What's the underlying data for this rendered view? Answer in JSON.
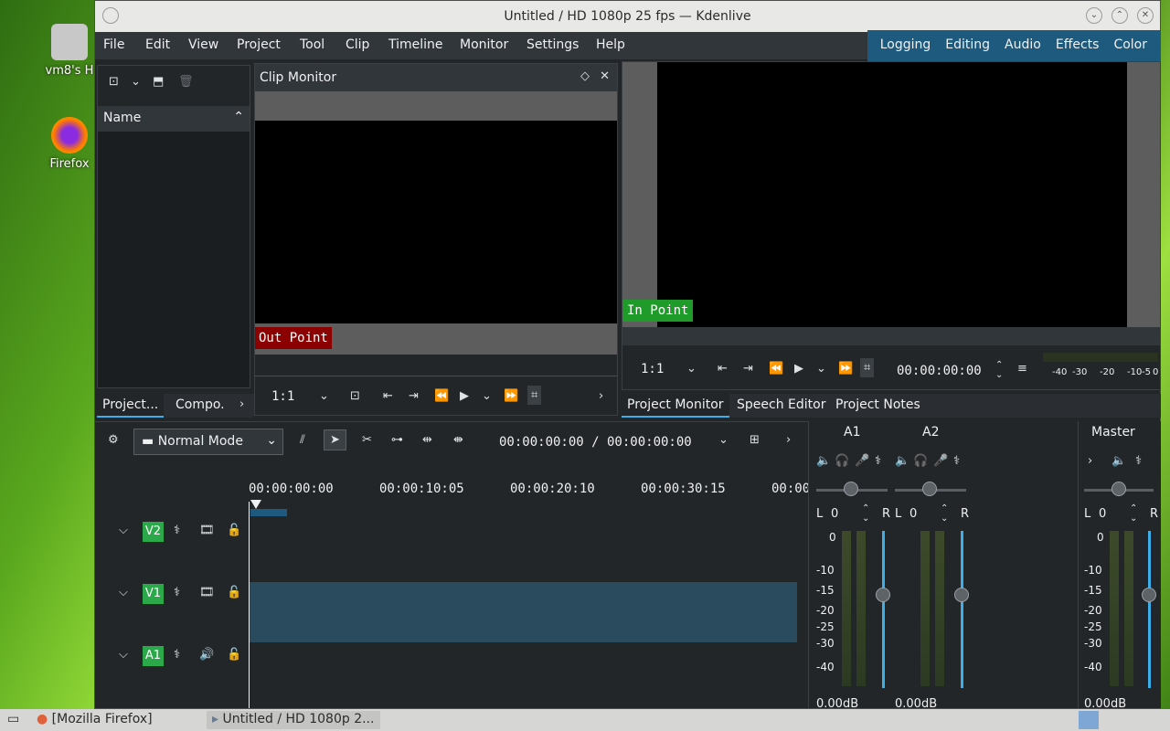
{
  "desktop": {
    "icons": [
      {
        "label": "vm8's H",
        "icon": "home-folder-icon"
      },
      {
        "label": "Firefox",
        "icon": "firefox-icon"
      }
    ]
  },
  "window": {
    "title": "Untitled / HD 1080p 25 fps — Kdenlive",
    "controls": {
      "minimize": "⌄",
      "maximize": "⌃",
      "close": "✕"
    }
  },
  "menubar": {
    "items": [
      "File",
      "Edit",
      "View",
      "Project",
      "Tool",
      "Clip",
      "Timeline",
      "Monitor",
      "Settings",
      "Help"
    ]
  },
  "layouts": [
    "Logging",
    "Editing",
    "Audio",
    "Effects",
    "Color"
  ],
  "bin": {
    "column_header": "Name",
    "tabs": [
      "Project...",
      "Compo."
    ]
  },
  "clip_monitor": {
    "title": "Clip Monitor",
    "out_point": "Out Point",
    "zoom": "1:1"
  },
  "project_monitor": {
    "in_point": "In Point",
    "zoom": "1:1",
    "timecode": "00:00:00:00",
    "meter_scale": [
      "-40",
      "-30",
      "-20",
      "-10",
      "-5",
      "0"
    ],
    "tabs": [
      "Project Monitor",
      "Speech Editor",
      "Project Notes"
    ]
  },
  "timeline": {
    "mode": "Normal Mode",
    "timecode": "00:00:00:00 / 00:00:00:00",
    "ruler": [
      "00:00:00:00",
      "00:00:10:05",
      "00:00:20:10",
      "00:00:30:15",
      "00:00"
    ],
    "tracks": [
      {
        "name": "V2",
        "type": "video"
      },
      {
        "name": "V1",
        "type": "video"
      },
      {
        "name": "A1",
        "type": "audio"
      }
    ]
  },
  "mixer": {
    "channels": [
      {
        "name": "A1",
        "pan": "0",
        "left": "L",
        "right": "R",
        "db": "0.00dB"
      },
      {
        "name": "A2",
        "pan": "0",
        "left": "L",
        "right": "R",
        "db": "0.00dB"
      },
      {
        "name": "Master",
        "pan": "0",
        "left": "L",
        "right": "R",
        "db": "0.00dB"
      }
    ],
    "scale": [
      "0",
      "-10",
      "-15",
      "-20",
      "-25",
      "-30",
      "-40"
    ]
  },
  "taskbar": {
    "items": [
      "[Mozilla Firefox]",
      "Untitled / HD 1080p 2..."
    ]
  },
  "colors": {
    "accent": "#3daee9",
    "layout_bar": "#1e5a7e",
    "out_point": "#8b0000",
    "in_point": "#1f9b2a",
    "track_badge": "#2aa84a"
  }
}
